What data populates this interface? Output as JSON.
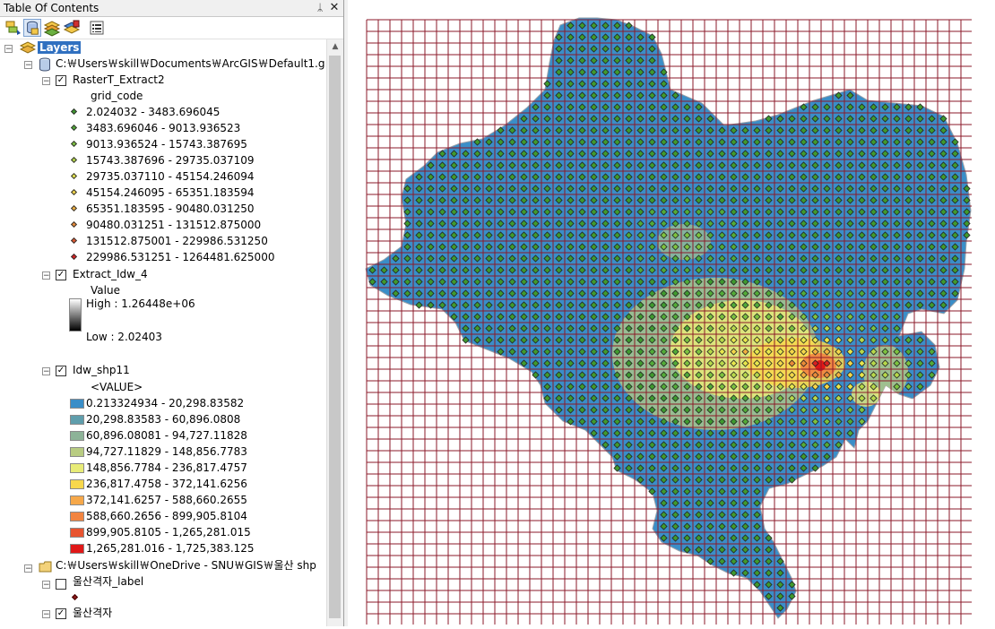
{
  "toc": {
    "title": "Table Of Contents",
    "pin_icon": "pin-icon",
    "close_icon": "close-icon",
    "tools": [
      "list-by-drawing-order-icon",
      "list-by-source-icon",
      "list-by-visibility-icon",
      "list-by-selection-icon",
      "options-icon"
    ],
    "layers_label": "Layers",
    "gdb_path": "C:￦Users￦skill￦Documents￦ArcGIS￦Default1.gdb",
    "raster_extract": {
      "name": "RasterT_Extract2",
      "field": "grid_code",
      "classes": [
        {
          "label": "2.024032 - 3483.696045",
          "color": "#3f9a2f"
        },
        {
          "label": "3483.696046 - 9013.936523",
          "color": "#52ab38"
        },
        {
          "label": "9013.936524 - 15743.387695",
          "color": "#7cc23f"
        },
        {
          "label": "15743.387696 - 29735.037109",
          "color": "#b6d84a"
        },
        {
          "label": "29735.037110 - 45154.246094",
          "color": "#e6e64d"
        },
        {
          "label": "45154.246095 - 65351.183594",
          "color": "#f2d64a"
        },
        {
          "label": "65351.183595 - 90480.031250",
          "color": "#f0b040"
        },
        {
          "label": "90480.031251 - 131512.875000",
          "color": "#e88a38"
        },
        {
          "label": "131512.875001 - 229986.531250",
          "color": "#e05a30"
        },
        {
          "label": "229986.531251 - 1264481.625000",
          "color": "#d82020"
        }
      ]
    },
    "extract_idw": {
      "name": "Extract_Idw_4",
      "field": "Value",
      "high": "High : 1.26448e+06",
      "low": "Low : 2.02403"
    },
    "idw_shp": {
      "name": "Idw_shp11",
      "field": "<VALUE>",
      "classes": [
        {
          "label": "0.213324934 - 20,298.83582",
          "color": "#3a8ec8"
        },
        {
          "label": "20,298.83583 - 60,896.0808",
          "color": "#5f9eac"
        },
        {
          "label": "60,896.08081 - 94,727.11828",
          "color": "#8db398"
        },
        {
          "label": "94,727.11829 - 148,856.7783",
          "color": "#b8cc82"
        },
        {
          "label": "148,856.7784 - 236,817.4757",
          "color": "#e8ec78"
        },
        {
          "label": "236,817.4758 - 372,141.6256",
          "color": "#f8d84c"
        },
        {
          "label": "372,141.6257 - 588,660.2655",
          "color": "#f6a84a"
        },
        {
          "label": "588,660.2656 - 899,905.8104",
          "color": "#f28440"
        },
        {
          "label": "899,905.8105 - 1,265,281.015",
          "color": "#e85430"
        },
        {
          "label": "1,265,281.016 - 1,725,383.125",
          "color": "#e01818"
        }
      ]
    },
    "shp_folder": "C:￦Users￦skill￦OneDrive - SNU￦GIS￦울산 shp",
    "label_layer": {
      "name": "울산격자_label",
      "checked": false,
      "symbol_color": "#8b1a1a"
    },
    "grid_layer": {
      "name": "울산격자",
      "checked": true
    }
  },
  "map": {
    "grid_line_color": "#8b1a2a",
    "region_fill_color": "#3a8ec8",
    "region_outline_color": "#9aa0a8"
  }
}
